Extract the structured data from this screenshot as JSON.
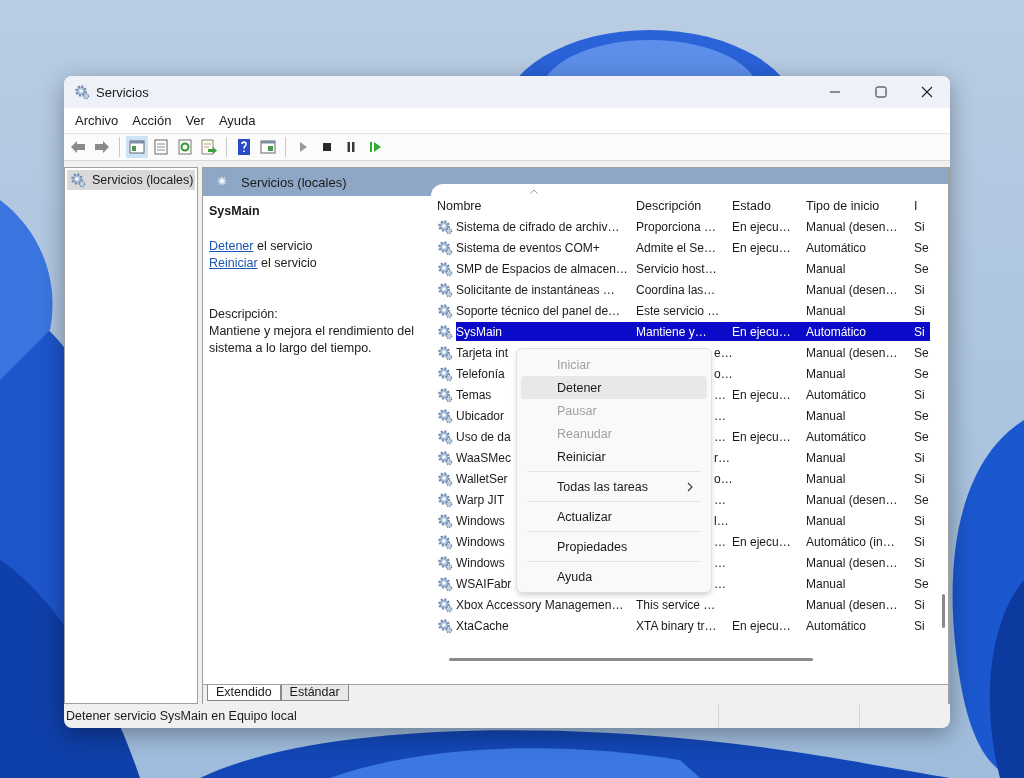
{
  "window": {
    "title": "Servicios"
  },
  "menu_bar": [
    "Archivo",
    "Acción",
    "Ver",
    "Ayuda"
  ],
  "toolbar": [
    {
      "kind": "back"
    },
    {
      "kind": "forward"
    },
    {
      "kind": "separator"
    },
    {
      "kind": "tree",
      "selected": true
    },
    {
      "kind": "properties",
      "selected": false
    },
    {
      "kind": "refresh",
      "selected": false
    },
    {
      "kind": "export",
      "selected": false
    },
    {
      "kind": "separator"
    },
    {
      "kind": "help",
      "selected": false
    },
    {
      "kind": "pane",
      "selected": false
    },
    {
      "kind": "separator"
    },
    {
      "kind": "play",
      "selected": false
    },
    {
      "kind": "stop",
      "selected": false
    },
    {
      "kind": "pause",
      "selected": false
    },
    {
      "kind": "resume",
      "selected": false
    }
  ],
  "tree": {
    "items": [
      {
        "label": "Servicios (locales)",
        "selected": true
      }
    ]
  },
  "pane_header": {
    "title": "Servicios (locales)"
  },
  "details": {
    "service_name": "SysMain",
    "actions": [
      {
        "link": "Detener",
        "text": " el servicio"
      },
      {
        "link": "Reiniciar",
        "text": " el servicio"
      }
    ],
    "description_label": "Descripción:",
    "description": "Mantiene y mejora el rendimiento del sistema a lo largo del tiempo."
  },
  "table": {
    "columns": [
      {
        "label": "Nombre",
        "sorted": true
      },
      {
        "label": "Descripción",
        "sorted": false
      },
      {
        "label": "Estado",
        "sorted": false
      },
      {
        "label": "Tipo de inicio",
        "sorted": false
      },
      {
        "label": "I",
        "sorted": false
      }
    ],
    "rows": [
      {
        "name": "Sistema de cifrado de archiv…",
        "description": "Proporciona …",
        "status": "En ejecu…",
        "startup": "Manual (desen…",
        "column_5": "Si",
        "selected": false
      },
      {
        "name": "Sistema de eventos COM+",
        "description": "Admite el Se…",
        "status": "En ejecu…",
        "startup": "Automático",
        "column_5": "Se",
        "selected": false
      },
      {
        "name": "SMP de Espacios de almacen…",
        "description": "Servicio host…",
        "startup": "Manual",
        "column_5": "Se",
        "selected": false
      },
      {
        "name": "Solicitante de instantáneas …",
        "description": "Coordina las…",
        "startup": "Manual (desen…",
        "column_5": "Si",
        "selected": false
      },
      {
        "name": "Soporte técnico del panel de…",
        "description": "Este servicio …",
        "startup": "Manual",
        "column_5": "Si",
        "selected": false
      },
      {
        "name": "SysMain",
        "description": "Mantiene y…",
        "status": "En ejecu…",
        "startup": "Automático",
        "column_5": "Si",
        "selected": true
      },
      {
        "name": "Tarjeta int",
        "description_tail": "e…",
        "startup": "Manual (desen…",
        "column_5": "Se",
        "selected": false
      },
      {
        "name": "Telefonía",
        "description_tail": "o…",
        "startup": "Manual",
        "column_5": "Se",
        "selected": false
      },
      {
        "name": "Temas",
        "description_tail": "…",
        "status": "En ejecu…",
        "startup": "Automático",
        "column_5": "Si",
        "selected": false
      },
      {
        "name": "Ubicador",
        "description_tail": "…",
        "startup": "Manual",
        "column_5": "Se",
        "selected": false
      },
      {
        "name": "Uso de da",
        "description_tail": "…",
        "status": "En ejecu…",
        "startup": "Automático",
        "column_5": "Se",
        "selected": false
      },
      {
        "name": "WaaSMec",
        "description_tail": "r…",
        "startup": "Manual",
        "column_5": "Si",
        "selected": false
      },
      {
        "name": "WalletSer",
        "description_tail": "o…",
        "startup": "Manual",
        "column_5": "Si",
        "selected": false
      },
      {
        "name": "Warp JIT",
        "description_tail": "…",
        "startup": "Manual (desen…",
        "column_5": "Se",
        "selected": false
      },
      {
        "name": "Windows",
        "description_tail": "l…",
        "startup": "Manual",
        "column_5": "Si",
        "selected": false
      },
      {
        "name": "Windows",
        "description_tail": "…",
        "status": "En ejecu…",
        "startup": "Automático (in…",
        "column_5": "Si",
        "selected": false
      },
      {
        "name": "Windows",
        "description_tail": "…",
        "startup": "Manual (desen…",
        "column_5": "Si",
        "selected": false
      },
      {
        "name": "WSAIFabr",
        "description_tail": "…",
        "startup": "Manual",
        "column_5": "Se",
        "selected": false
      },
      {
        "name": "Xbox Accessory Managemen…",
        "description": "This service …",
        "startup": "Manual (desen…",
        "column_5": "Si",
        "selected": false
      },
      {
        "name": "XtaCache",
        "description": "XTA binary tr…",
        "status": "En ejecu…",
        "startup": "Automático",
        "column_5": "Si",
        "selected": false
      }
    ]
  },
  "context_menu": {
    "items": [
      {
        "kind": "item",
        "label": "Iniciar",
        "disabled": true,
        "highlighted": false
      },
      {
        "kind": "item",
        "label": "Detener",
        "disabled": false,
        "highlighted": true
      },
      {
        "kind": "item",
        "label": "Pausar",
        "disabled": true,
        "highlighted": false
      },
      {
        "kind": "item",
        "label": "Reanudar",
        "disabled": true,
        "highlighted": false
      },
      {
        "kind": "item",
        "label": "Reiniciar",
        "disabled": false,
        "highlighted": false
      },
      {
        "kind": "separator"
      },
      {
        "kind": "submenu",
        "label": "Todas las tareas",
        "disabled": false,
        "highlighted": false
      },
      {
        "kind": "separator"
      },
      {
        "kind": "item",
        "label": "Actualizar",
        "disabled": false,
        "highlighted": false
      },
      {
        "kind": "separator"
      },
      {
        "kind": "item",
        "label": "Propiedades",
        "disabled": false,
        "highlighted": false
      },
      {
        "kind": "separator"
      },
      {
        "kind": "item",
        "label": "Ayuda",
        "disabled": false,
        "highlighted": false
      }
    ]
  },
  "view_tabs": [
    {
      "label": "Extendido",
      "selected": true
    },
    {
      "label": "Estándar",
      "selected": false
    }
  ],
  "status_bar": {
    "text": "Detener servicio SysMain en Equipo local"
  }
}
